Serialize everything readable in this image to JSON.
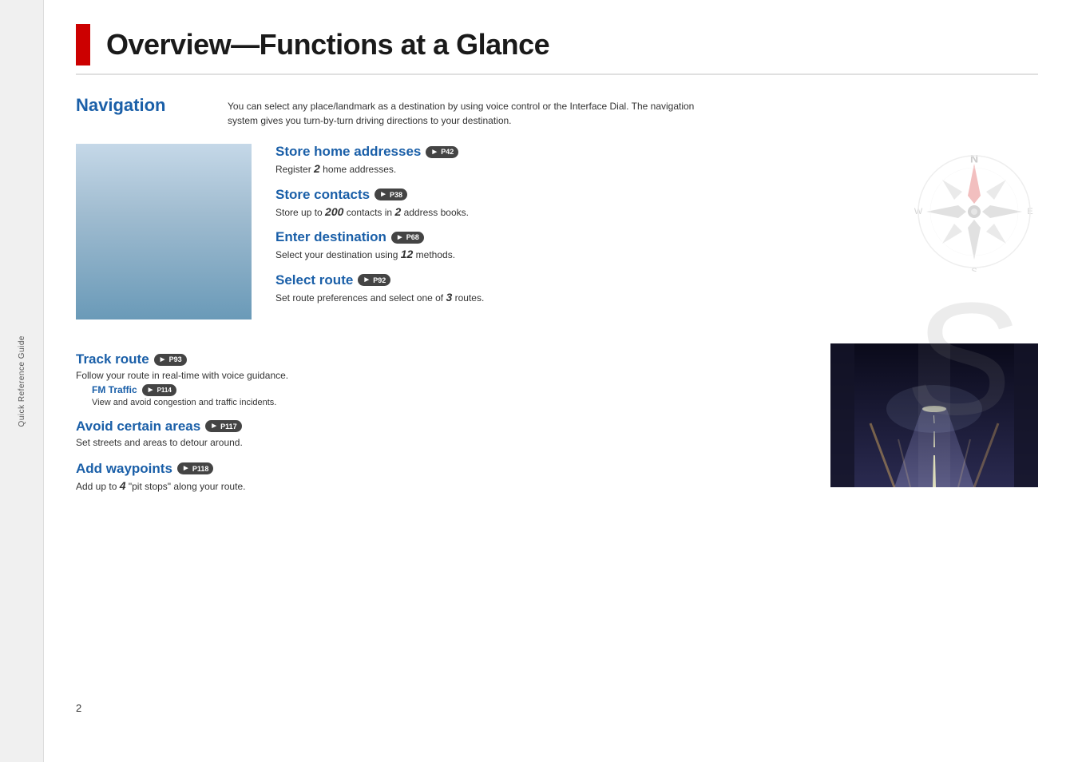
{
  "sidebar": {
    "label": "Quick Reference Guide"
  },
  "page": {
    "title": "Overview—Functions at a Glance",
    "number": "2"
  },
  "navigation": {
    "section_title": "Navigation",
    "description": "You can select any place/landmark as a destination by using voice control or the Interface Dial. The navigation system gives you turn-by-turn driving directions to your destination.",
    "features": [
      {
        "title": "Store home addresses",
        "badge": "P42",
        "desc_text": "Register ",
        "desc_num": "2",
        "desc_suffix": " home addresses."
      },
      {
        "title": "Store contacts",
        "badge": "P38",
        "desc_text": "Store up to ",
        "desc_num": "200",
        "desc_suffix": " contacts in ",
        "desc_num2": "2",
        "desc_suffix2": " address books."
      },
      {
        "title": "Enter destination",
        "badge": "P68",
        "desc_text": "Select your destination using ",
        "desc_num": "12",
        "desc_suffix": " methods."
      },
      {
        "title": "Select route",
        "badge": "P92",
        "desc_text": "Set route preferences and select one of ",
        "desc_num": "3",
        "desc_suffix": " routes."
      }
    ],
    "lower_features": [
      {
        "title": "Track route",
        "badge": "P93",
        "desc": "Follow your route in real-time with voice guidance.",
        "sub": {
          "title": "FM Traffic",
          "badge": "P114",
          "desc": "View and avoid congestion and traffic incidents."
        }
      },
      {
        "title": "Avoid certain areas",
        "badge": "P117",
        "desc": "Set streets and areas to detour around."
      },
      {
        "title": "Add waypoints",
        "badge": "P118",
        "desc_text": "Add up to ",
        "desc_num": "4",
        "desc_suffix": " \"pit stops\" along your route."
      }
    ]
  }
}
